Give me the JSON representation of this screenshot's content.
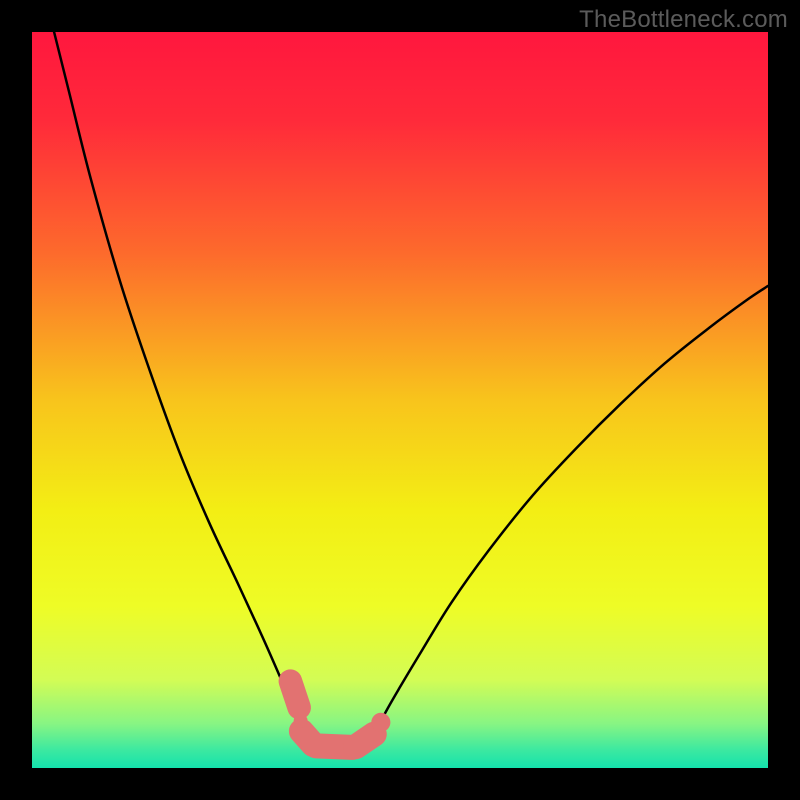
{
  "watermark": "TheBottleneck.com",
  "chart_data": {
    "type": "line",
    "title": "",
    "xlabel": "",
    "ylabel": "",
    "xlim": [
      0,
      100
    ],
    "ylim": [
      0,
      100
    ],
    "grid": false,
    "legend": false,
    "background": {
      "type": "vertical-gradient",
      "stops": [
        {
          "offset": 0.0,
          "color": "#ff173e"
        },
        {
          "offset": 0.12,
          "color": "#ff2a3a"
        },
        {
          "offset": 0.3,
          "color": "#fd6a2c"
        },
        {
          "offset": 0.5,
          "color": "#f8c41c"
        },
        {
          "offset": 0.65,
          "color": "#f3ee14"
        },
        {
          "offset": 0.78,
          "color": "#eefc26"
        },
        {
          "offset": 0.88,
          "color": "#d3fc55"
        },
        {
          "offset": 0.94,
          "color": "#87f583"
        },
        {
          "offset": 0.975,
          "color": "#3de9a0"
        },
        {
          "offset": 1.0,
          "color": "#14e2ad"
        }
      ]
    },
    "series": [
      {
        "name": "left-curve",
        "stroke": "#000000",
        "stroke_width": 2.5,
        "points": [
          {
            "x": 3.0,
            "y": 100.0
          },
          {
            "x": 5.0,
            "y": 92.0
          },
          {
            "x": 8.0,
            "y": 80.0
          },
          {
            "x": 12.0,
            "y": 66.0
          },
          {
            "x": 16.0,
            "y": 54.0
          },
          {
            "x": 20.0,
            "y": 43.0
          },
          {
            "x": 24.0,
            "y": 33.5
          },
          {
            "x": 28.0,
            "y": 25.0
          },
          {
            "x": 31.0,
            "y": 18.5
          },
          {
            "x": 33.0,
            "y": 14.0
          },
          {
            "x": 34.5,
            "y": 10.5
          },
          {
            "x": 35.5,
            "y": 8.0
          },
          {
            "x": 36.5,
            "y": 5.3
          }
        ]
      },
      {
        "name": "right-curve",
        "stroke": "#000000",
        "stroke_width": 2.5,
        "points": [
          {
            "x": 47.0,
            "y": 5.3
          },
          {
            "x": 48.0,
            "y": 7.5
          },
          {
            "x": 50.0,
            "y": 11.0
          },
          {
            "x": 53.0,
            "y": 16.0
          },
          {
            "x": 57.0,
            "y": 22.5
          },
          {
            "x": 62.0,
            "y": 29.5
          },
          {
            "x": 68.0,
            "y": 37.0
          },
          {
            "x": 74.0,
            "y": 43.5
          },
          {
            "x": 80.0,
            "y": 49.5
          },
          {
            "x": 86.0,
            "y": 55.0
          },
          {
            "x": 92.0,
            "y": 59.8
          },
          {
            "x": 97.0,
            "y": 63.5
          },
          {
            "x": 100.0,
            "y": 65.5
          }
        ]
      }
    ],
    "markers": {
      "name": "data-markers",
      "fill": "#e27271",
      "stroke": "#e27271",
      "points_capsule": [
        {
          "x1": 35.1,
          "y1": 11.8,
          "x2": 36.3,
          "y2": 8.2,
          "r": 1.6
        },
        {
          "x1": 36.6,
          "y1": 5.0,
          "x2": 38.2,
          "y2": 3.2,
          "r": 1.7
        },
        {
          "x1": 38.6,
          "y1": 3.0,
          "x2": 43.5,
          "y2": 2.8,
          "r": 1.7
        },
        {
          "x1": 44.0,
          "y1": 2.9,
          "x2": 46.5,
          "y2": 4.6,
          "r": 1.7
        }
      ],
      "points_dot": [
        {
          "x": 36.5,
          "y": 6.4,
          "r": 0.95
        },
        {
          "x": 47.4,
          "y": 6.2,
          "r": 1.3
        }
      ]
    }
  }
}
